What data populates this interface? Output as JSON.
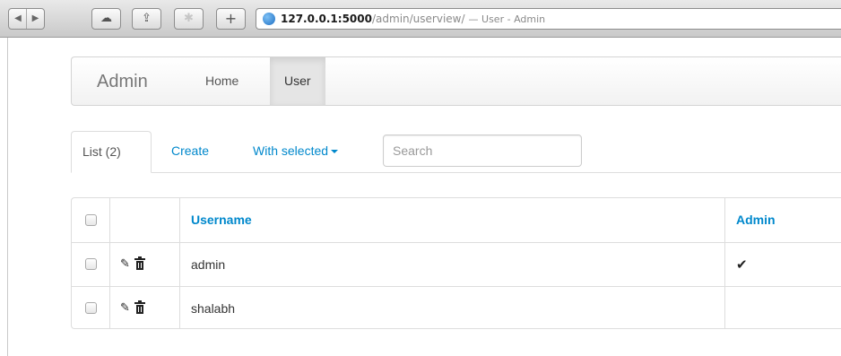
{
  "browser": {
    "nav_back_glyph": "◀",
    "nav_forward_glyph": "▶",
    "cloud_glyph": "☁",
    "share_glyph": "⇪",
    "extension_glyph": "✱",
    "new_tab_glyph": "+",
    "url_host": "127.0.0.1:5000",
    "url_path": "/admin/userview/",
    "page_title": "— User - Admin"
  },
  "navbar": {
    "brand": "Admin",
    "links": [
      {
        "label": "Home",
        "active": false
      },
      {
        "label": "User",
        "active": true
      }
    ]
  },
  "tabs": {
    "list_label": "List (2)",
    "create_label": "Create",
    "with_selected_label": "With selected"
  },
  "search": {
    "placeholder": "Search",
    "value": ""
  },
  "table": {
    "columns": [
      "Username",
      "Admin"
    ],
    "rows": [
      {
        "username": "admin",
        "admin_mark": "✔"
      },
      {
        "username": "shalabh",
        "admin_mark": ""
      }
    ]
  },
  "icons": {
    "edit": "pencil-icon",
    "delete": "trash-icon",
    "admin_true": "check-icon"
  },
  "colors": {
    "link": "#0088cc",
    "navbar_active_bg": "#e5e5e5",
    "border": "#dddddd"
  }
}
